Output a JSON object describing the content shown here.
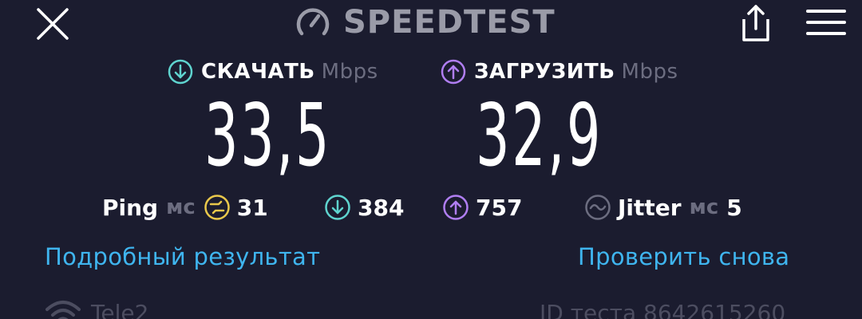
{
  "header": {
    "brand": "SPEEDTEST",
    "brand_icon": "gauge-icon",
    "close_icon": "close-icon",
    "share_icon": "share-icon",
    "menu_icon": "menu-icon"
  },
  "download": {
    "label": "СКАЧАТЬ",
    "unit": "Mbps",
    "value": "33,5",
    "icon": "download-arrow-icon",
    "accent": "#5fd4cf"
  },
  "upload": {
    "label": "ЗАГРУЗИТЬ",
    "unit": "Mbps",
    "value": "32,9",
    "icon": "upload-arrow-icon",
    "accent": "#b07ef2"
  },
  "stats": {
    "ping_label": "Ping",
    "ping_unit": "мс",
    "ping_value": "31",
    "ping_accent": "#e9c84b",
    "dl_latency": "384",
    "ul_latency": "757",
    "jitter_label": "Jitter",
    "jitter_unit": "мс",
    "jitter_value": "5"
  },
  "links": {
    "detail": "Подробный результат",
    "again": "Проверить снова",
    "color": "#3fb5ef"
  },
  "footer": {
    "carrier": "Tele2",
    "test_id": "ID теста 8642615260"
  }
}
